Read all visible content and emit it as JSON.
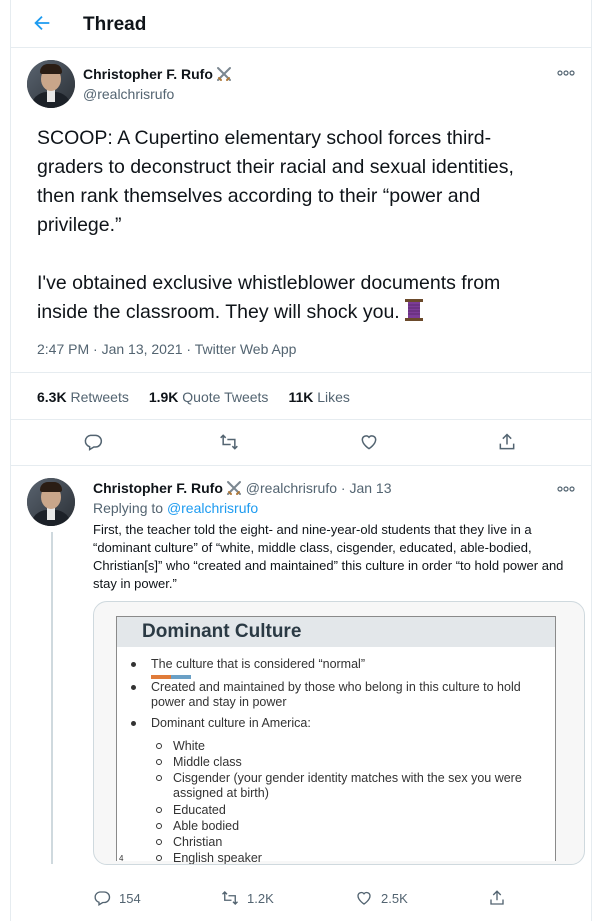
{
  "header": {
    "title": "Thread"
  },
  "main_tweet": {
    "author_name": "Christopher F. Rufo",
    "author_handle": "@realchrisrufo",
    "text": "SCOOP: A Cupertino elementary school forces third-\ngraders to deconstruct their racial and sexual identities,\nthen rank themselves according to their “power and\nprivilege.”\n\nI've obtained exclusive whistleblower documents from\ninside the classroom. They will shock you.",
    "timestamp": "2:47 PM · Jan 13, 2021 · Twitter Web App",
    "stats": {
      "retweets_count": "6.3K",
      "retweets_label": "Retweets",
      "quotes_count": "1.9K",
      "quotes_label": "Quote Tweets",
      "likes_count": "11K",
      "likes_label": "Likes"
    },
    "icons": [
      "reply-icon",
      "retweet-icon",
      "like-icon",
      "share-icon"
    ]
  },
  "reply_tweet": {
    "author_name": "Christopher F. Rufo",
    "meta": "@realchrisrufo · Jan 13",
    "replying_prefix": "Replying to",
    "replying_handle": "@realchrisrufo",
    "text": "First, the teacher told the eight- and nine-year-old students that they live in a “dominant culture” of “white, middle class, cisgender, educated, able-bodied, Christian[s]” who “created and maintained” this culture in order “to hold power and stay in power.”",
    "slide": {
      "title": "Dominant Culture",
      "bullets": [
        "The culture that is considered “normal”",
        "Created and maintained by those who belong in this culture to hold",
        "power and stay in power",
        "Dominant culture in America:"
      ],
      "sub_bullets": [
        "White",
        "Middle class",
        "Cisgender (your gender identity matches with the sex you were",
        "assigned at birth)",
        "Educated",
        "Able bodied",
        "Christian",
        "English speaker"
      ],
      "page_number": "4"
    },
    "actions": {
      "replies": "154",
      "retweets": "1.2K",
      "likes": "2.5K"
    }
  },
  "colors": {
    "accent": "#1d9bf0",
    "muted": "#536471",
    "border": "#e6ecf0"
  }
}
